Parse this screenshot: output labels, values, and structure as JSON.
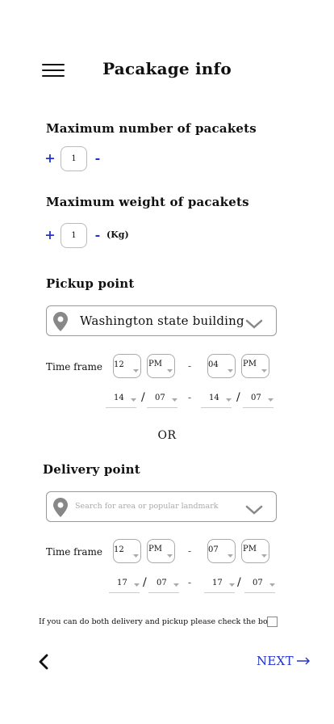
{
  "header": {
    "title": "Pacakage info"
  },
  "packets": {
    "label": "Maximum number of pacakets",
    "plus": "+",
    "minus": "-",
    "value": "1"
  },
  "weight": {
    "label": "Maximum weight of pacakets",
    "plus": "+",
    "minus": "-",
    "value": "1",
    "unit": "(Kg)"
  },
  "pickup": {
    "label": "Pickup point",
    "location": "Washington state building",
    "time_label": "Time frame",
    "from_hour": "12",
    "from_period": "PM",
    "to_hour": "04",
    "to_period": "PM",
    "dash": "-",
    "start_day": "14",
    "start_month": "07",
    "end_day": "14",
    "end_month": "07",
    "slash": "/"
  },
  "or_text": "OR",
  "delivery": {
    "label": "Delivery point",
    "placeholder": "Search for area or popular landmark",
    "time_label": "Time frame",
    "from_hour": "12",
    "from_period": "PM",
    "to_hour": "07",
    "to_period": "PM",
    "dash": "-",
    "start_day": "17",
    "start_month": "07",
    "end_day": "17",
    "end_month": "07",
    "slash": "/"
  },
  "both_note": "If you can do both delivery and pickup please check the box",
  "footer": {
    "next_label": "NEXT"
  },
  "colors": {
    "accent": "#2233cc",
    "icon_gray": "#888888"
  }
}
